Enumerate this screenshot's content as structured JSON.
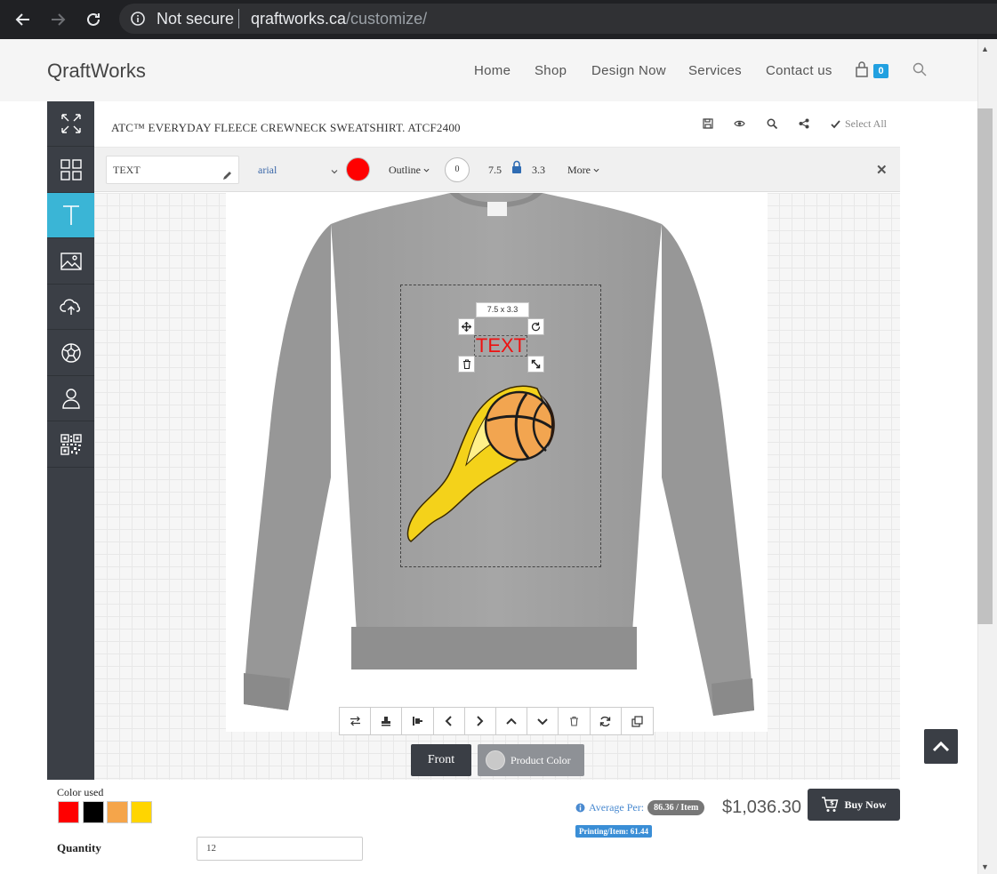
{
  "browser": {
    "security_label": "Not secure",
    "url_host": "qraftworks.ca",
    "url_path": "/customize/"
  },
  "site": {
    "logo": "QraftWorks",
    "nav": [
      "Home",
      "Shop",
      "Design Now",
      "Services",
      "Contact us"
    ],
    "cart_count": "0"
  },
  "sidebar": {
    "tools": [
      {
        "name": "fullscreen-icon"
      },
      {
        "name": "products-grid-icon"
      },
      {
        "name": "text-tool-icon",
        "active": true
      },
      {
        "name": "image-icon"
      },
      {
        "name": "upload-cloud-icon"
      },
      {
        "name": "sports-ball-icon"
      },
      {
        "name": "user-icon"
      },
      {
        "name": "qr-code-icon"
      }
    ]
  },
  "designer": {
    "product_title": "ATC™ EVERYDAY FLEECE CREWNECK SWEATSHIRT. ATCF2400",
    "select_all_label": "Select All"
  },
  "text_toolbar": {
    "text_value": "TEXT",
    "font": "arial",
    "text_color": "#ff0000",
    "outline_label": "Outline",
    "rotation": "0",
    "width": "7.5",
    "height": "3.3",
    "more_label": "More"
  },
  "canvas": {
    "size_label": "7.5 x 3.3",
    "text_object": "TEXT",
    "product_color": "#9a9a9a"
  },
  "view": {
    "front_label": "Front",
    "product_color_label": "Product Color"
  },
  "summary": {
    "color_used_label": "Color used",
    "colors_used": [
      "#ff0000",
      "#000000",
      "#f5a54a",
      "#ffd500"
    ],
    "quantity_label": "Quantity",
    "quantity": "12",
    "average_per_label": "Average Per:",
    "average_per_value": "86.36 / Item",
    "printing_per_item": "Printing/Item: 61.44",
    "total_price": "$1,036.30",
    "buy_now_label": "Buy Now"
  },
  "colors": {
    "accent": "#3ab5d6",
    "sidebar_bg": "#3b3f46",
    "cart_badge": "#21a0e0",
    "link_blue": "#4a8ad0"
  }
}
